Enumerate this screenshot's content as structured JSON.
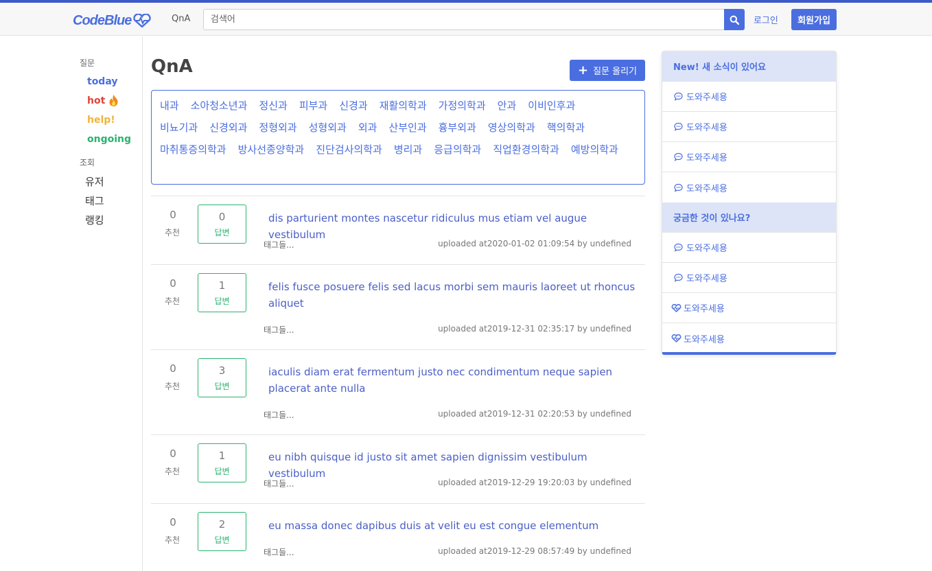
{
  "navbar": {
    "logo": "CodeBlue",
    "qna": "QnA",
    "search_placeholder": "검색어",
    "login": "로그인",
    "signup": "회원가입"
  },
  "sidebar": {
    "question_section": "질문",
    "filters": [
      {
        "label": "today",
        "color": "#4a6ee0"
      },
      {
        "label": "hot",
        "color": "#e0433a"
      },
      {
        "label": "help!",
        "color": "#f0b43c"
      },
      {
        "label": "ongoing",
        "color": "#2ab36e"
      }
    ],
    "browse_section": "조회",
    "browse_items": [
      "유저",
      "태그",
      "랭킹"
    ]
  },
  "main": {
    "title": "QnA",
    "ask_button": "질문 올리기",
    "departments": [
      "내과",
      "소아청소년과",
      "정신과",
      "피부과",
      "신경과",
      "재활의학과",
      "가정의학과",
      "안과",
      "이비인후과",
      "비뇨기과",
      "신경외과",
      "정형외과",
      "성형외과",
      "외과",
      "산부인과",
      "흉부외과",
      "영상의학과",
      "핵의학과",
      "마취통증의학과",
      "방사선종양학과",
      "진단검사의학과",
      "병리과",
      "응급의학과",
      "직업환경의학과",
      "예방의학과"
    ],
    "vote_label": "추천",
    "answer_label": "답변",
    "questions": [
      {
        "votes": "0",
        "answers": "0",
        "title": "dis parturient montes nascetur ridiculus mus etiam vel augue vestibulum",
        "tags": "태그들...",
        "meta": "uploaded at2020-01-02 01:09:54 by undefined"
      },
      {
        "votes": "0",
        "answers": "1",
        "title": "felis fusce posuere felis sed lacus morbi sem mauris laoreet ut rhoncus aliquet",
        "tags": "태그들...",
        "meta": "uploaded at2019-12-31 02:35:17 by undefined"
      },
      {
        "votes": "0",
        "answers": "3",
        "title": "iaculis diam erat fermentum justo nec condimentum neque sapien placerat ante nulla",
        "tags": "태그들...",
        "meta": "uploaded at2019-12-31 02:20:53 by undefined"
      },
      {
        "votes": "0",
        "answers": "1",
        "title": "eu nibh quisque id justo sit amet sapien dignissim vestibulum vestibulum",
        "tags": "태그들...",
        "meta": "uploaded at2019-12-29 19:20:03 by undefined"
      },
      {
        "votes": "0",
        "answers": "2",
        "title": "eu massa donec dapibus duis at velit eu est congue elementum",
        "tags": "태그들...",
        "meta": "uploaded at2019-12-29 08:57:49 by undefined"
      }
    ]
  },
  "right_panel": {
    "news_header": "New! 새 소식이 있어요",
    "news_items": [
      "도와주세용",
      "도와주세용",
      "도와주세용",
      "도와주세용"
    ],
    "curious_header": "궁금한 것이 있나요?",
    "curious_items": [
      {
        "label": "도와주세용",
        "icon": "comment-icon"
      },
      {
        "label": "도와주세용",
        "icon": "comment-icon"
      },
      {
        "label": "도와주세용",
        "icon": "heartbeat-icon"
      },
      {
        "label": "도와주세용",
        "icon": "heartbeat-icon"
      }
    ]
  },
  "colors": {
    "accent": "#4a6ee0",
    "green": "#2ab36e"
  }
}
